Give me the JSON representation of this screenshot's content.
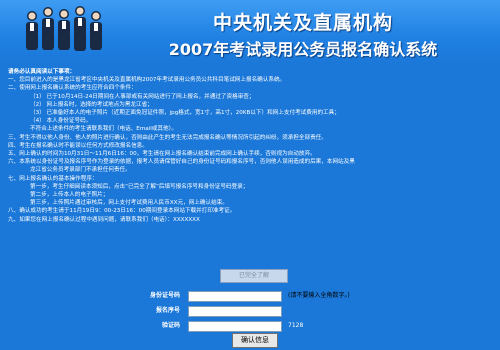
{
  "header": {
    "title_line1": "中央机关及直属机构",
    "title_line2": "2007年考试录用公务员报名确认系统"
  },
  "notice": {
    "heading": "请务必认真阅读以下事项：",
    "lines": [
      "一、您目前进入的是黑龙江省考区中央机关及直属机构2007年考试录用公务员公共科目笔试网上报名确认系统。",
      "二、使用网上报名确认系统的考生应符合四个条件：",
      "（1）  已于10月14日-24日期间在人事部或有关网站进行了网上报名，并通过了资格审查；",
      "（2）  网上报名时，选择的考试地点为黑龙江省；",
      "（3）  已准备好本人的电子照片（近期正面免冠证件照，jpg格式，宽1寸，高1寸，20KB以下）和网上支付考试费用的工具；",
      "（4）  本人身份证号码，",
      "不符合上述条件的考生请联系我们（电话、Email或其他）。",
      "三、考生不得以他人身份、他人的照片进行确认，否则由此产生的考生无法完成报名确认等情况所引起的纠纷，须承担全部责任。",
      "四、考生在报名确认时不能误以任何方式修改报名信息。",
      "五、网上确认的时间为10月31日～11月6日16：00，考生请在网上报名确认结束前完成网上确认手续，否则视为自动放弃。",
      "六、本系统以身份证号及报名序号作为登录的依据，报考人员请保管好自己的身份证号码和报名序号，否则他人误用造成的后果，本网站及黑",
      "龙江省公务员考录部门不承担任何责任。",
      "七、网上报名确认的基本操作程序：",
      "第一步，考生仔细阅读本须知后，点击“已完全了解”后填写报名序号和身份证号码登录；",
      "第二步，上传本人的电子照片；",
      "第三步，上传照片通过审核后，网上支付考试费用人民币XX元，网上确认结束。",
      "八、确认成功的考生请于11月19日9：00-23日16：00期间登录本网站下载并打印准考证。",
      "九、如果您在网上报名确认过程中遇到问题，请联系我们（电话）：XXXXXXX"
    ]
  },
  "confirm_button": {
    "label": "已完全了解"
  },
  "login_form": {
    "id_label": "身份证号码",
    "id_hint": "(请不要输入全角数字。)",
    "serial_label": "报名序号",
    "code_label": "验证码",
    "captcha_text": "7128",
    "submit_label": "确认信息"
  }
}
